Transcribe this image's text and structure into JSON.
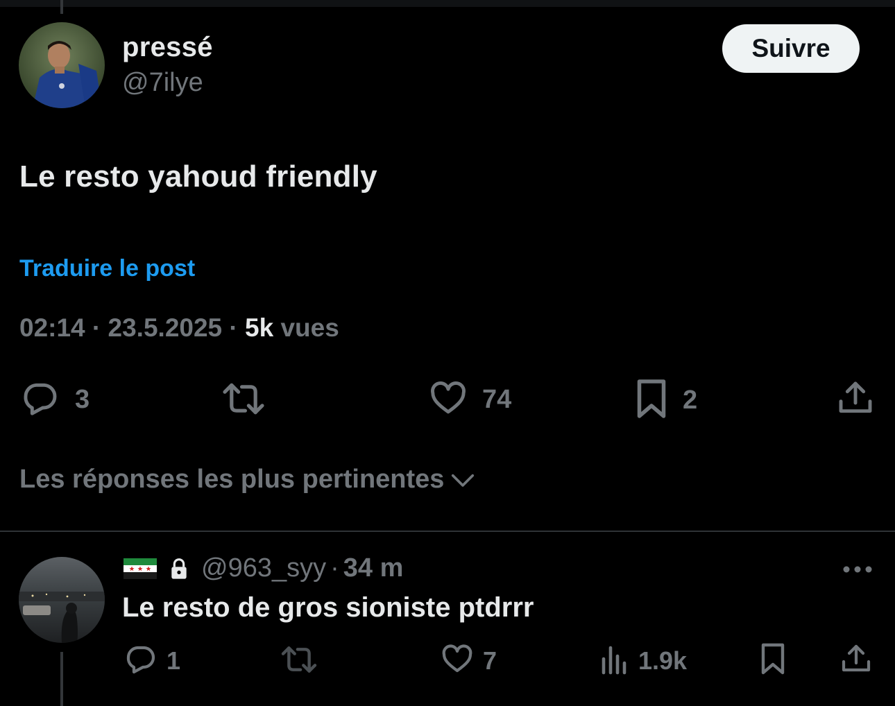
{
  "post": {
    "author_name": "pressé",
    "author_handle": "@7ilye",
    "follow_label": "Suivre",
    "text": "Le resto yahoud friendly",
    "translate_label": "Traduire le post",
    "time": "02:14",
    "date": "23.5.2025",
    "views_count": "5k",
    "views_label": "vues",
    "actions": {
      "replies": "3",
      "likes": "74",
      "bookmarks": "2"
    }
  },
  "sort_label": "Les réponses les plus pertinentes",
  "reply": {
    "handle": "@963_syy",
    "time": "34 m",
    "text": "Le resto de gros sioniste ptdrrr",
    "actions": {
      "replies": "1",
      "likes": "7",
      "views": "1.9k"
    }
  },
  "colors": {
    "background": "#000000",
    "text_primary": "#e7e9ea",
    "text_secondary": "#71767b",
    "link": "#1d9bf0",
    "follow_bg": "#eff3f4"
  },
  "icons": [
    "reply-icon",
    "repost-icon",
    "like-icon",
    "bookmark-icon",
    "share-icon",
    "views-icon",
    "lock-icon",
    "flag-icon",
    "more-icon",
    "chevron-down-icon"
  ]
}
